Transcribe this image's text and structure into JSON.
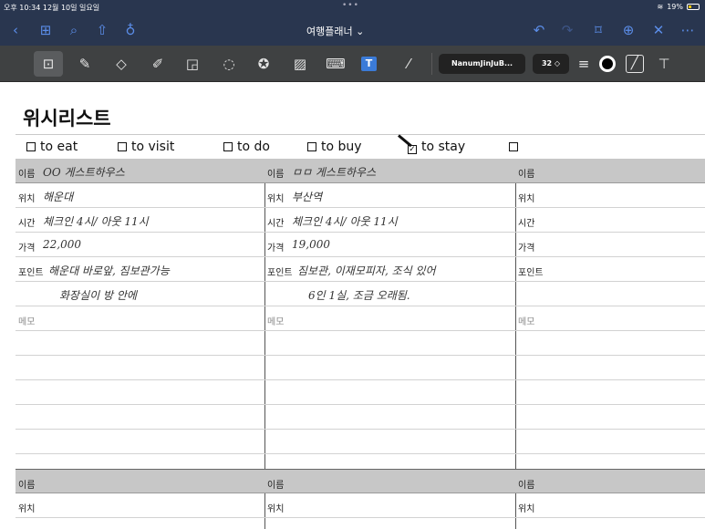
{
  "status": {
    "time_date": "오후 10:34  12월 10일 일요일",
    "dots": "•••",
    "battery": "19%"
  },
  "nav": {
    "title": "여행플래너 ⌄"
  },
  "toolbar": {
    "font_name": "NanumJinJuB...",
    "font_size": "32 ◇"
  },
  "doc": {
    "title": "위시리스트"
  },
  "categories": [
    {
      "label": "to eat",
      "checked": false
    },
    {
      "label": "to visit",
      "checked": false
    },
    {
      "label": "to do",
      "checked": false
    },
    {
      "label": "to buy",
      "checked": false
    },
    {
      "label": "to stay",
      "checked": true
    },
    {
      "label": "",
      "checked": false
    }
  ],
  "columns": [
    {
      "name_label": "이름",
      "name": "OO 게스트하우스",
      "location_label": "위치",
      "location": "해운대",
      "time_label": "시간",
      "time": "체크인 4시/ 아웃 11시",
      "price_label": "가격",
      "price": "22,000",
      "point_label": "포인트",
      "point1": "해운대 바로앞, 짐보관가능",
      "point2": "화장실이 방 안에",
      "memo_label": "메모",
      "next_name_label": "이름",
      "next_location_label": "위치"
    },
    {
      "name_label": "이름",
      "name": "ㅁㅁ 게스트하우스",
      "location_label": "위치",
      "location": "부산역",
      "time_label": "시간",
      "time": "체크인 4시/ 아웃 11시",
      "price_label": "가격",
      "price": "19,000",
      "point_label": "포인트",
      "point1": "짐보관, 이재모피자, 조식 있어",
      "point2": "6인 1실, 조금 오래됨.",
      "memo_label": "메모",
      "next_name_label": "이름",
      "next_location_label": "위치"
    },
    {
      "name_label": "이름",
      "name": "",
      "location_label": "위치",
      "location": "",
      "time_label": "시간",
      "time": "",
      "price_label": "가격",
      "price": "",
      "point_label": "포인트",
      "point1": "",
      "point2": "",
      "memo_label": "메모",
      "next_name_label": "이름",
      "next_location_label": "위치"
    }
  ]
}
